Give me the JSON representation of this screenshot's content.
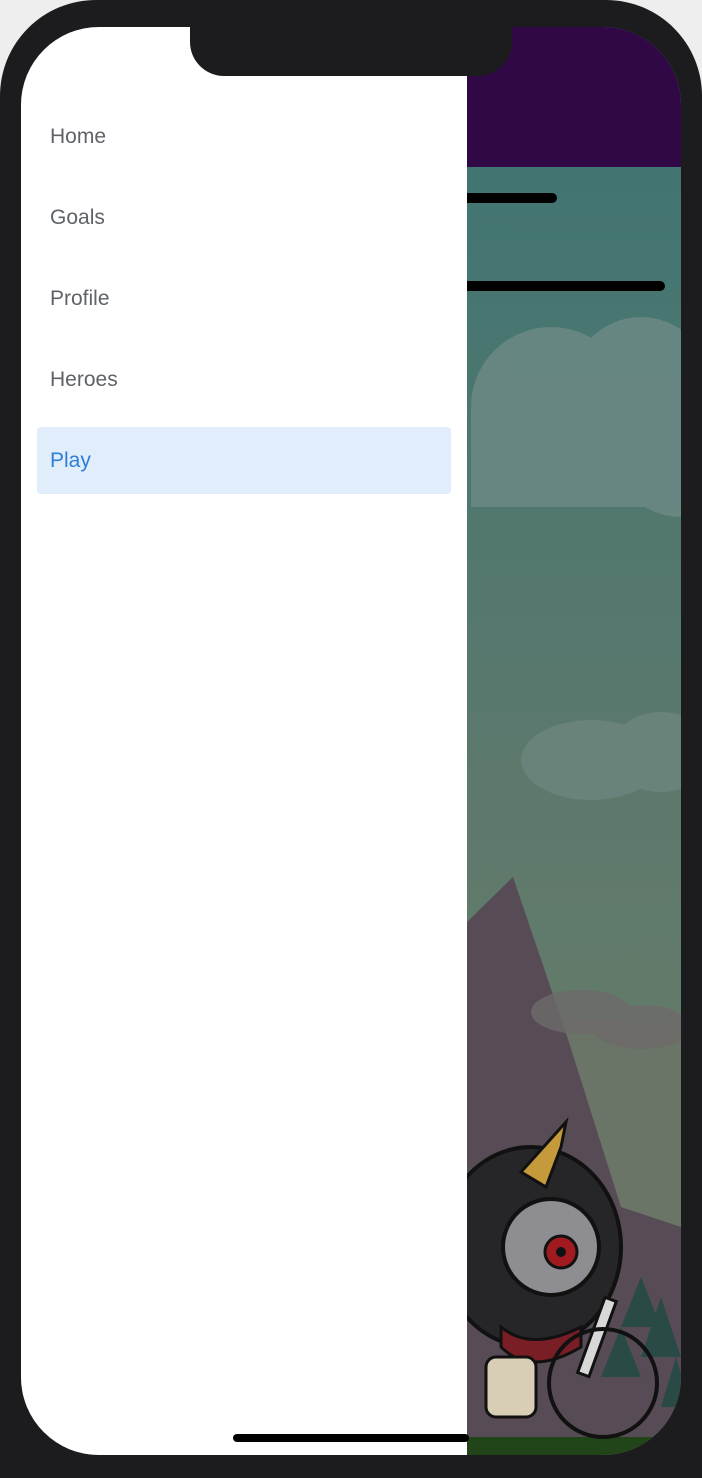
{
  "drawer": {
    "items": [
      {
        "label": "Home",
        "active": false
      },
      {
        "label": "Goals",
        "active": false
      },
      {
        "label": "Profile",
        "active": false
      },
      {
        "label": "Heroes",
        "active": false
      },
      {
        "label": "Play",
        "active": true
      }
    ]
  },
  "colors": {
    "header_bar": "#300845",
    "sky_top": "#3c7674",
    "sky_bottom": "#6b7c66",
    "drawer_bg": "#ffffff",
    "active_item_bg": "#e1edfb",
    "active_item_text": "#2b7fd6",
    "item_text": "#5f6368",
    "device_frame": "#1c1c1e"
  },
  "icons": {
    "character": "one-eyed-horned-monster-icon",
    "action_button": "circle-button-icon"
  }
}
